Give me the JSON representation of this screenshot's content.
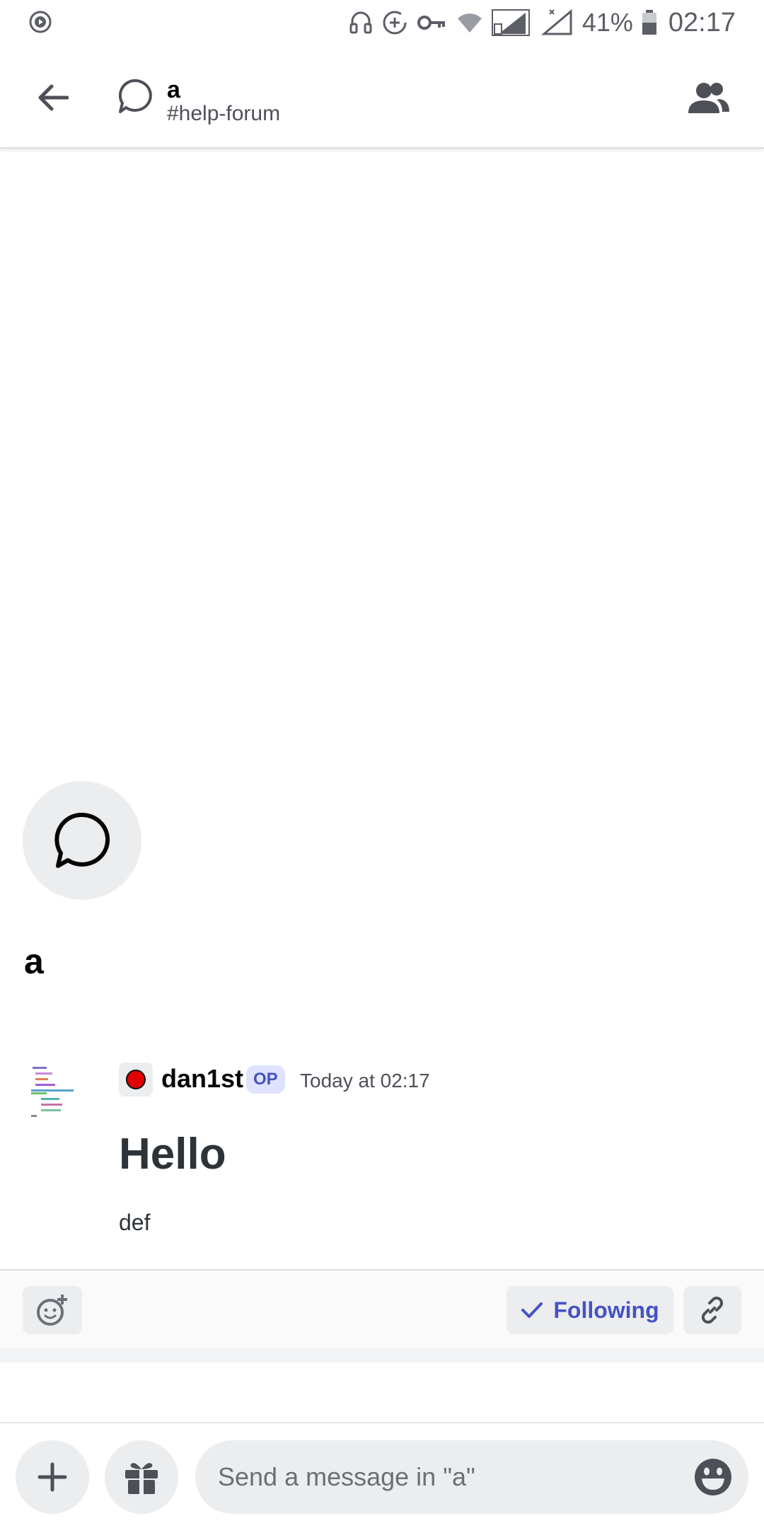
{
  "status_bar": {
    "battery": "41%",
    "time": "02:17"
  },
  "header": {
    "title": "a",
    "channel": "#help-forum"
  },
  "post": {
    "title": "a"
  },
  "message": {
    "author": "dan1st",
    "badge": "OP",
    "timestamp": "Today at 02:17",
    "heading": "Hello",
    "body": "def"
  },
  "actions": {
    "following_label": "Following"
  },
  "composer": {
    "placeholder": "Send a message in \"a\""
  },
  "colors": {
    "accent": "#4752c4",
    "role_dot": "#e00000"
  },
  "icons": [
    "play-circle-icon",
    "headset-icon",
    "data-saver-icon",
    "vpn-key-icon",
    "wifi-icon",
    "signal-icon",
    "battery-icon",
    "back-arrow-icon",
    "thread-bubble-icon",
    "members-icon",
    "add-reaction-icon",
    "checkmark-icon",
    "link-icon",
    "plus-icon",
    "gift-icon",
    "emoji-icon"
  ]
}
